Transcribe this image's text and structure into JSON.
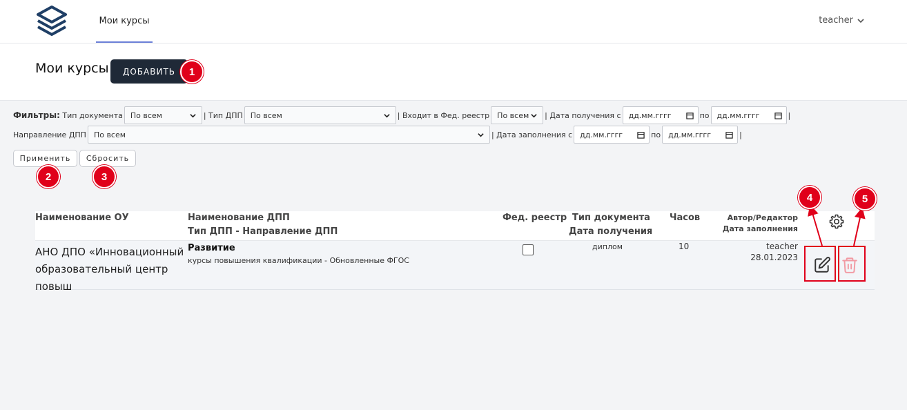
{
  "nav": {
    "tab_label": "Мои курсы",
    "user": "teacher"
  },
  "header": {
    "title": "Мои курсы",
    "add_label": "ДОБАВИТЬ"
  },
  "filters": {
    "title": "Фильтры:",
    "doc_type_label": "Тип документа",
    "doc_type_value": "По всем",
    "dpp_type_label": "| Тип ДПП",
    "dpp_type_value": "По всем",
    "registry_label": "| Входит в Фед. реестр",
    "registry_value": "По всем",
    "received_label": "| Дата получения с",
    "received_from": "дд.мм.гггг",
    "to_label": "по",
    "received_to": "дд.мм.гггг",
    "sep": "|",
    "direction_label": "Направление ДПП",
    "direction_value": "По всем",
    "filled_label": "| Дата заполнения с",
    "filled_from": "дд.мм.гггг",
    "filled_to_label": "по",
    "filled_to": "дд.мм.гггг",
    "sep2": "|",
    "apply_label": "Применить",
    "reset_label": "Сбросить"
  },
  "table": {
    "headers": {
      "org": "Наименование ОУ",
      "dpp_name": "Наименование ДПП",
      "dpp_type_dir": "Тип ДПП - Направление ДПП",
      "registry": "Фед. реестр",
      "doc_type": "Тип документа",
      "received": "Дата получения",
      "hours": "Часов",
      "author": "Автор/Редактор",
      "filled": "Дата заполнения"
    },
    "rows": [
      {
        "org": "АНО ДПО «Инновационный образовательный центр повыш",
        "dpp_name": "Развитие",
        "dpp_type_dir": "курсы повышения квалификации - Обновленные ФГОС",
        "registry_checked": false,
        "doc_type": "диплом",
        "hours": "10",
        "author": "teacher",
        "filled": "28.01.2023"
      }
    ]
  },
  "annotations": [
    "1",
    "2",
    "3",
    "4",
    "5"
  ],
  "colors": {
    "accent": "#6b7fd7",
    "dark_button": "#1f2937",
    "annotation": "#e0001a",
    "delete_icon": "#f29aa3"
  }
}
